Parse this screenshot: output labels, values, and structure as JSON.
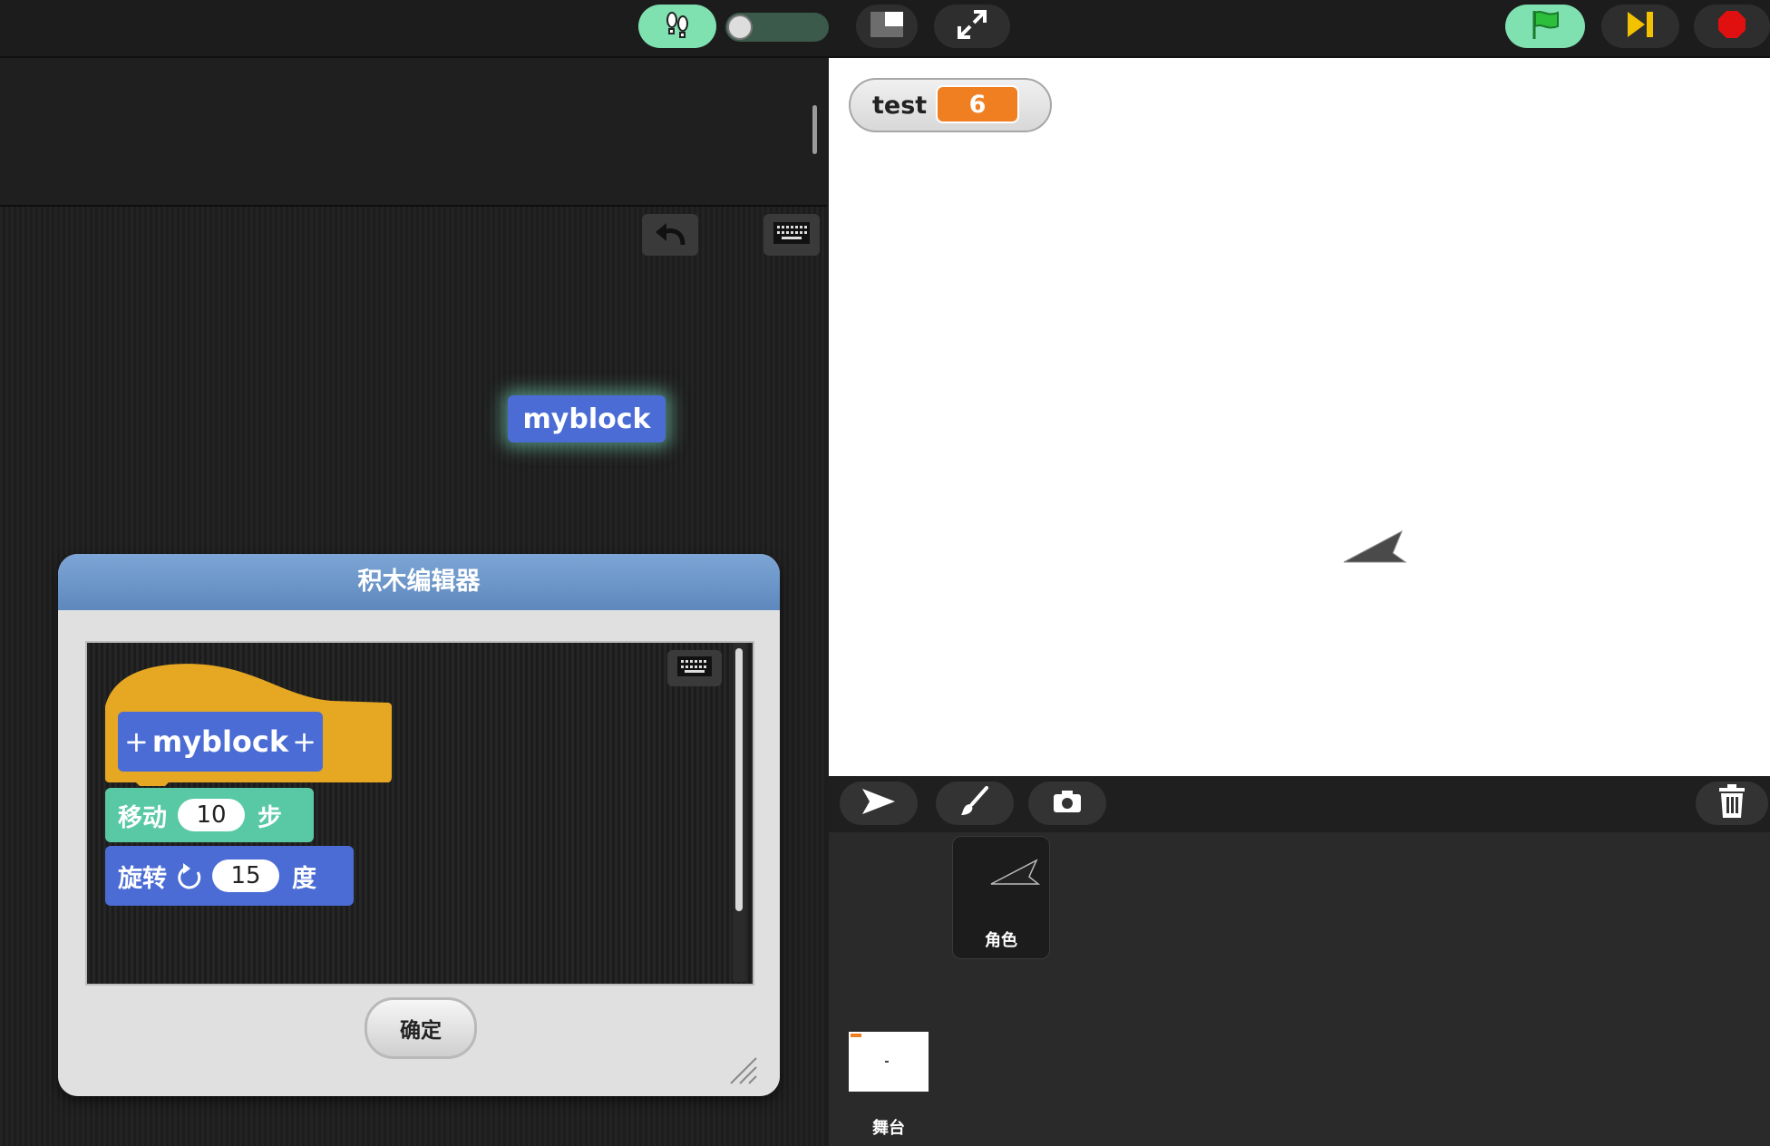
{
  "stage": {
    "watcher": {
      "label": "test",
      "value": "6"
    }
  },
  "scripts": {
    "floating_block": {
      "label": "myblock"
    }
  },
  "block_editor": {
    "title": "积木编辑器",
    "hat_block": {
      "prefix": "+",
      "label": "myblock",
      "suffix": "+"
    },
    "blocks": [
      {
        "label": "移动",
        "input": "10",
        "unit": "步"
      },
      {
        "label": "旋转",
        "input": "15",
        "unit": "度"
      }
    ],
    "ok_label": "确定"
  },
  "corral": {
    "sprite": {
      "label": "角色"
    },
    "stage_thumb": {
      "label": "舞台"
    }
  },
  "colors": {
    "motion_blue": "#4a6cd4",
    "motion_teal": "#59c9a5",
    "control_orange": "#e6a823",
    "variable_orange": "#f07f21",
    "flag_green": "#7fe0b0",
    "stop_red": "#e01010",
    "pause_yellow": "#f2c200"
  }
}
